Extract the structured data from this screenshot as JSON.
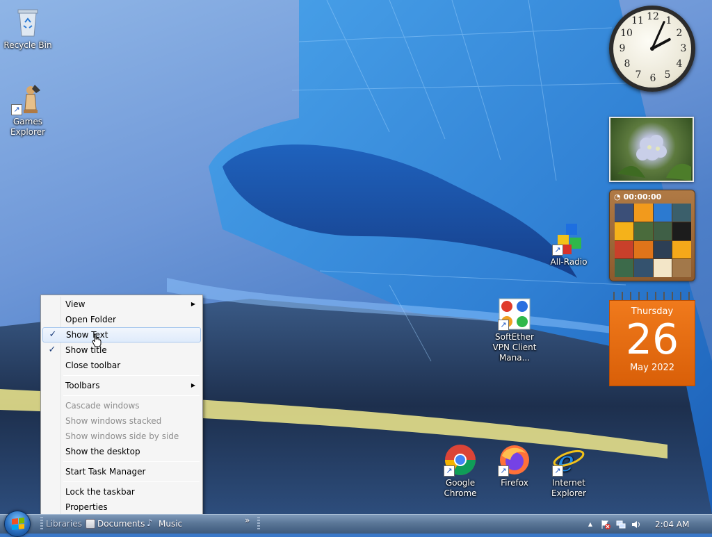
{
  "desktop": {
    "icons": [
      {
        "name": "recycle-bin",
        "label": "Recycle Bin"
      },
      {
        "name": "games-explorer",
        "label": "Games Explorer"
      },
      {
        "name": "all-radio",
        "label": "All-Radio"
      },
      {
        "name": "softether-vpn",
        "label": "SoftEther VPN Client Mana..."
      },
      {
        "name": "google-chrome",
        "label": "Google Chrome"
      },
      {
        "name": "firefox",
        "label": "Firefox"
      },
      {
        "name": "internet-explorer",
        "label": "Internet Explorer"
      }
    ]
  },
  "gadgets": {
    "clock": {
      "numbers": [
        "12",
        "1",
        "2",
        "3",
        "4",
        "5",
        "6",
        "7",
        "8",
        "9",
        "10",
        "11"
      ],
      "hour": 2,
      "minute": 4
    },
    "puzzle": {
      "timer": "00:00:00"
    },
    "calendar": {
      "weekday": "Thursday",
      "day": "26",
      "month_year": "May 2022"
    }
  },
  "context_menu": {
    "items": [
      {
        "label": "View",
        "submenu": true
      },
      {
        "label": "Open Folder"
      },
      {
        "label": "Show Text",
        "checked": true,
        "highlighted": true
      },
      {
        "label": "Show title",
        "checked": true
      },
      {
        "label": "Close toolbar"
      },
      {
        "label": "Toolbars",
        "submenu": true
      },
      {
        "label": "Cascade windows",
        "disabled": true
      },
      {
        "label": "Show windows stacked",
        "disabled": true
      },
      {
        "label": "Show windows side by side",
        "disabled": true
      },
      {
        "label": "Show the desktop"
      },
      {
        "label": "Start Task Manager"
      },
      {
        "label": "Lock the taskbar"
      },
      {
        "label": "Properties"
      }
    ],
    "check_glyph": "✓",
    "submenu_glyph": "▶"
  },
  "taskbar": {
    "toolbar_items": [
      "Libraries",
      "Documents",
      "Music"
    ],
    "chevron": "»",
    "tray_up_arrow": "▲",
    "time": "2:04 AM"
  },
  "colors": {
    "menu_highlight_border": "#a8c8ee",
    "calendar_orange": "#f07a1c",
    "taskbar_blue": "#5a7697"
  }
}
